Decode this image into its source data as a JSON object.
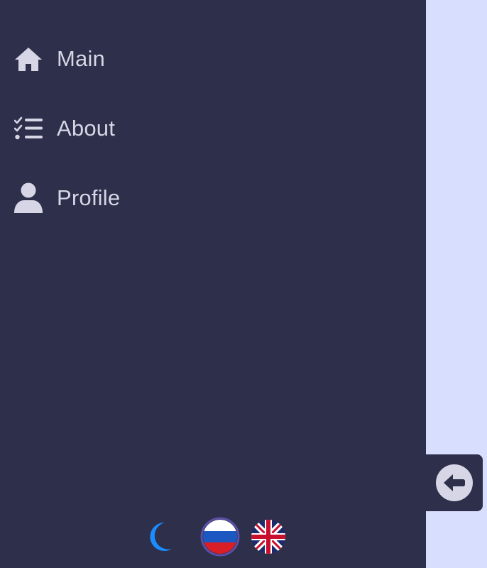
{
  "sidebar": {
    "background": "#2e2f4a",
    "items": [
      {
        "label": "Main",
        "icon": "home-icon"
      },
      {
        "label": "About",
        "icon": "checklist-icon"
      },
      {
        "label": "Profile",
        "icon": "user-icon"
      }
    ]
  },
  "footer": {
    "theme_icon": "moon-icon",
    "theme_color": "#1a8cff",
    "languages": [
      {
        "code": "ru",
        "icon": "russia-flag-icon",
        "active": true
      },
      {
        "code": "en",
        "icon": "uk-flag-icon",
        "active": false
      }
    ]
  },
  "collapse": {
    "icon": "arrow-left-circle-icon"
  },
  "colors": {
    "page_background": "#d8defe",
    "text": "#d6d6e6",
    "active_ring": "#5b4fa8"
  }
}
